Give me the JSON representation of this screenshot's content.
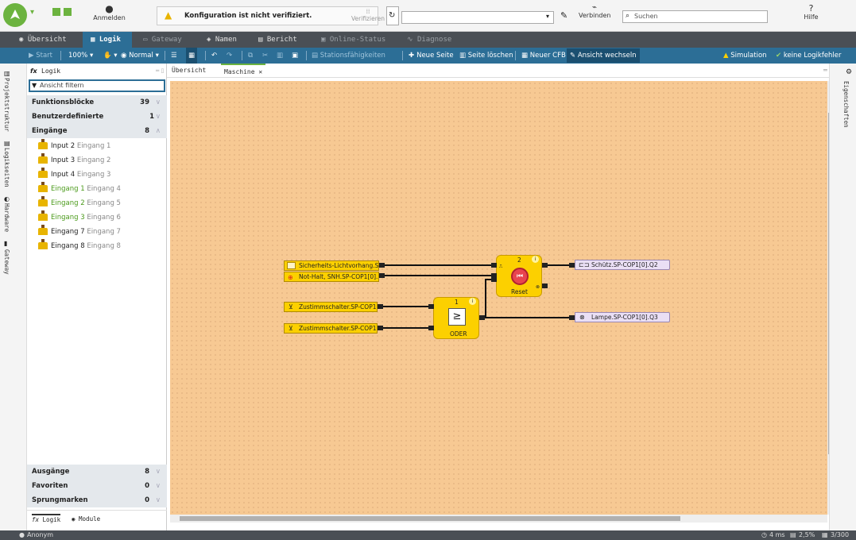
{
  "top": {
    "login": "Anmelden",
    "warning": "Konfiguration ist nicht verifiziert.",
    "verify": "Verifizieren",
    "connect": "Verbinden",
    "search_placeholder": "Suchen",
    "help": "Hilfe"
  },
  "nav": [
    "Übersicht",
    "Logik",
    "Gateway",
    "Namen",
    "Bericht",
    "Online-Status",
    "Diagnose"
  ],
  "toolbar": {
    "start": "Start",
    "zoom": "100%",
    "mode": "Normal",
    "station": "Stationsfähigkeiten",
    "new_page": "Neue Seite",
    "delete_page": "Seite löschen",
    "new_cfb": "Neuer CFB",
    "switch_view": "Ansicht wechseln",
    "simulation": "Simulation",
    "no_errors": "keine Logikfehler"
  },
  "left_tabs": [
    "Projektstruktur",
    "Logikseiten",
    "Hardware",
    "Gateway"
  ],
  "panel": {
    "title": "Logik",
    "filter_placeholder": "Ansicht filtern",
    "categories": [
      {
        "name": "Funktionsblöcke",
        "count": "39"
      },
      {
        "name": "Benutzerdefinierte Funktionsblöcke",
        "count": "1"
      },
      {
        "name": "Eingänge",
        "count": "8"
      }
    ],
    "items": [
      {
        "name": "Input 2",
        "sub": "Eingang 1"
      },
      {
        "name": "Input 3",
        "sub": "Eingang 2"
      },
      {
        "name": "Input 4",
        "sub": "Eingang 3"
      },
      {
        "name": "Eingang 1",
        "sub": "Eingang 4"
      },
      {
        "name": "Eingang 2",
        "sub": "Eingang 5"
      },
      {
        "name": "Eingang 3",
        "sub": "Eingang 6"
      },
      {
        "name": "Eingang 7",
        "sub": "Eingang 7"
      },
      {
        "name": "Eingang 8",
        "sub": "Eingang 8"
      }
    ],
    "bottom_categories": [
      {
        "name": "Ausgänge",
        "count": "8"
      },
      {
        "name": "Favoriten",
        "count": "0"
      },
      {
        "name": "Sprungmarken",
        "count": "0"
      }
    ],
    "bottom_tabs": [
      "Logik",
      "Module"
    ]
  },
  "tabs": [
    "Übersicht",
    "Maschine"
  ],
  "right_tab": "Eigenschaften",
  "diagram": {
    "inputs": [
      "Sicherheits-Lichtvorhang.S...",
      "Not-Halt, SNH.SP-COP1[0]...",
      "Zustimmschalter.SP-COP1[...",
      "Zustimmschalter.SP-COP1[..."
    ],
    "outputs": [
      "Schütz.SP-COP1[0].Q2",
      "Lampe.SP-COP1[0].Q3"
    ],
    "reset_block": {
      "num": "2",
      "label": "Reset"
    },
    "or_block": {
      "num": "1",
      "label": "ODER",
      "symbol": "≥"
    }
  },
  "status": {
    "user": "Anonym",
    "time": "4 ms",
    "percent": "2,5%",
    "count": "3/300"
  },
  "colors": {
    "accent": "#2c6e96",
    "block": "#fcd000",
    "canvas": "#f7c993"
  }
}
